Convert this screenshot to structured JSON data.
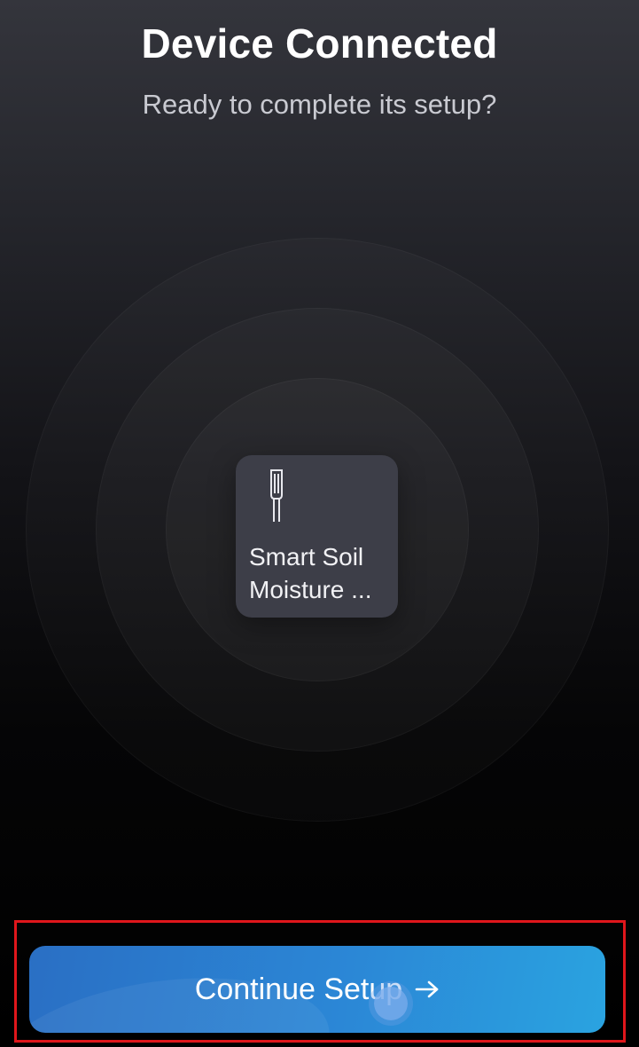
{
  "header": {
    "title": "Device Connected",
    "subtitle": "Ready to complete its setup?"
  },
  "device": {
    "name": "Smart Soil Moisture ...",
    "icon": "soil-probe-icon"
  },
  "actions": {
    "continue_label": "Continue Setup",
    "continue_icon": "arrow-right-icon"
  },
  "colors": {
    "button_start": "#2a6fc4",
    "button_end": "#2aa3e0",
    "card_bg": "#3d3e48",
    "highlight": "#e0161b"
  }
}
